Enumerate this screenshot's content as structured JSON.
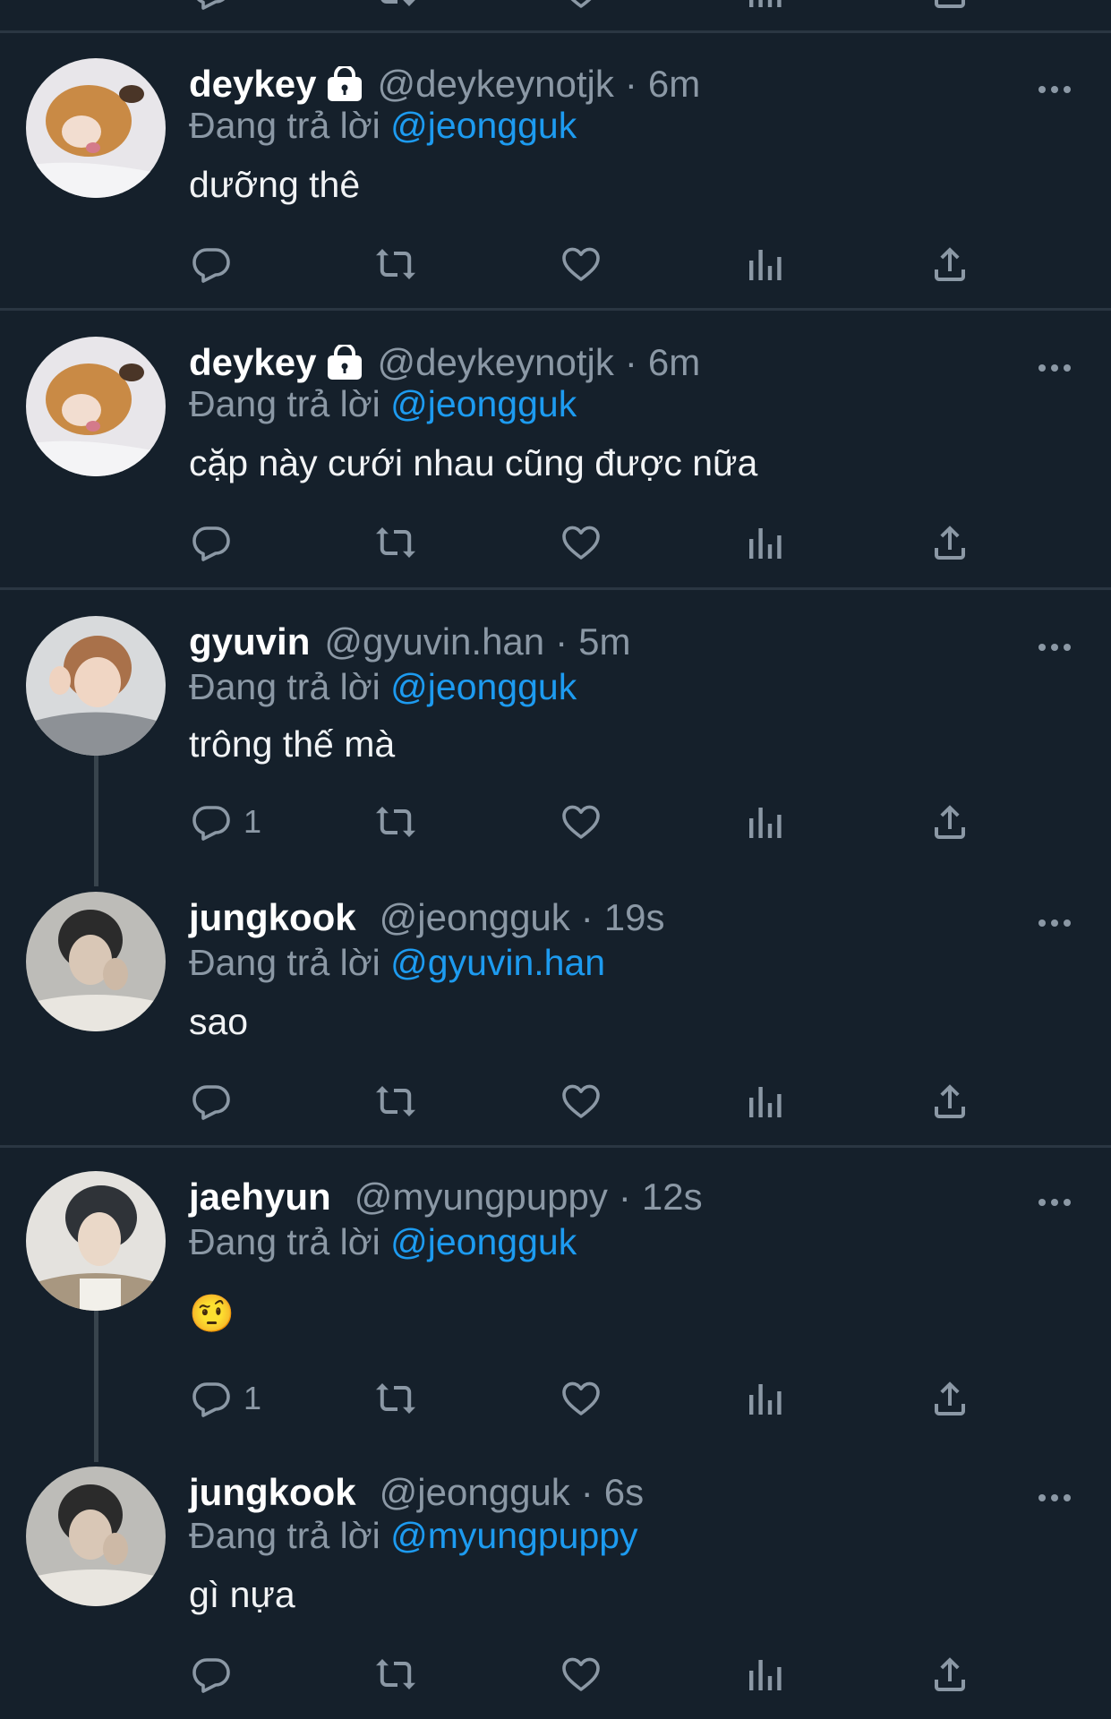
{
  "colors": {
    "background": "#15202b",
    "divider": "#2a3642",
    "secondary_text": "#8b98a5",
    "mention": "#1d9bf0",
    "primary_text": "#ffffff"
  },
  "reply_prefix": "Đang trả lời",
  "icons": [
    "reply-icon",
    "retweet-icon",
    "like-icon",
    "views-icon",
    "share-icon",
    "more-icon",
    "lock-icon"
  ],
  "tweets": [
    {
      "name": "deykey",
      "verified_lock": true,
      "handle": "@deykeynotjk",
      "time": "6m",
      "reply_to": "@jeongguk",
      "text": "dưỡng thê",
      "reply_count": ""
    },
    {
      "name": "deykey",
      "verified_lock": true,
      "handle": "@deykeynotjk",
      "time": "6m",
      "reply_to": "@jeongguk",
      "text": "cặp này cưới nhau cũng được nữa",
      "reply_count": ""
    },
    {
      "name": "gyuvin",
      "verified_lock": false,
      "handle": "@gyuvin.han",
      "time": "5m",
      "reply_to": "@jeongguk",
      "text": "trông thế mà",
      "reply_count": "1"
    },
    {
      "name": "jungkook",
      "verified_lock": false,
      "handle": "@jeongguk",
      "time": "19s",
      "reply_to": "@gyuvin.han",
      "text": "sao",
      "reply_count": ""
    },
    {
      "name": "jaehyun",
      "verified_lock": false,
      "handle": "@myungpuppy",
      "time": "12s",
      "reply_to": "@jeongguk",
      "text": "🤨",
      "reply_count": "1"
    },
    {
      "name": "jungkook",
      "verified_lock": false,
      "handle": "@jeongguk",
      "time": "6s",
      "reply_to": "@myungpuppy",
      "text": "gì nựa",
      "reply_count": ""
    }
  ]
}
